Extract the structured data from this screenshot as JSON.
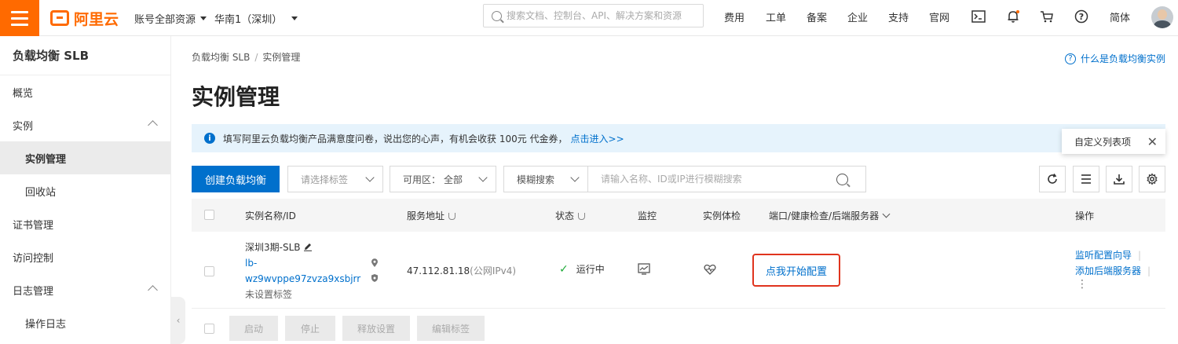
{
  "topbar": {
    "logo_text": "阿里云",
    "account_scope": "账号全部资源",
    "region": "华南1（深圳）",
    "search_placeholder": "搜索文档、控制台、API、解决方案和资源",
    "links": [
      "费用",
      "工单",
      "备案",
      "企业",
      "支持",
      "官网"
    ],
    "icons": [
      "terminal-icon",
      "bell-icon",
      "cart-icon",
      "help-icon"
    ],
    "language": "简体",
    "brand_color": "#ff6a00"
  },
  "sidebar": {
    "title": "负载均衡 SLB",
    "items": [
      {
        "label": "概览"
      },
      {
        "label": "实例"
      },
      {
        "label": "实例管理"
      },
      {
        "label": "回收站"
      },
      {
        "label": "证书管理"
      },
      {
        "label": "访问控制"
      },
      {
        "label": "日志管理"
      },
      {
        "label": "操作日志"
      }
    ]
  },
  "main": {
    "breadcrumb": [
      "负载均衡 SLB",
      "实例管理"
    ],
    "help_link": "什么是负载均衡实例",
    "title": "实例管理",
    "notice_text": "填写阿里云负载均衡产品满意度问卷，说出您的心声，有机会收获 100元 代金券，",
    "notice_link": "点击进入>>",
    "popup_text": "自定义列表项"
  },
  "toolbar": {
    "create_label": "创建负载均衡",
    "tag_placeholder": "请选择标签",
    "zone_label": "可用区：",
    "zone_value": "全部",
    "search_mode": "模糊搜索",
    "search_placeholder": "请输入名称、ID或IP进行模糊搜索"
  },
  "table": {
    "headers": [
      "实例名称/ID",
      "服务地址",
      "状态",
      "监控",
      "实例体检",
      "端口/健康检查/后端服务器",
      "操作"
    ],
    "rows": [
      {
        "name": "深圳3期-SLB",
        "id_line1": "lb-",
        "id_line2": "wz9wvppe97zvza9xsbjrr",
        "tag": "未设置标签",
        "address": "47.112.81.18",
        "address_type": "(公网IPv4)",
        "status": "运行中",
        "config_link": "点我开始配置",
        "actions": [
          "监听配置向导",
          "添加后端服务器"
        ]
      }
    ]
  },
  "bottom_actions": [
    "启动",
    "停止",
    "释放设置",
    "编辑标签"
  ]
}
